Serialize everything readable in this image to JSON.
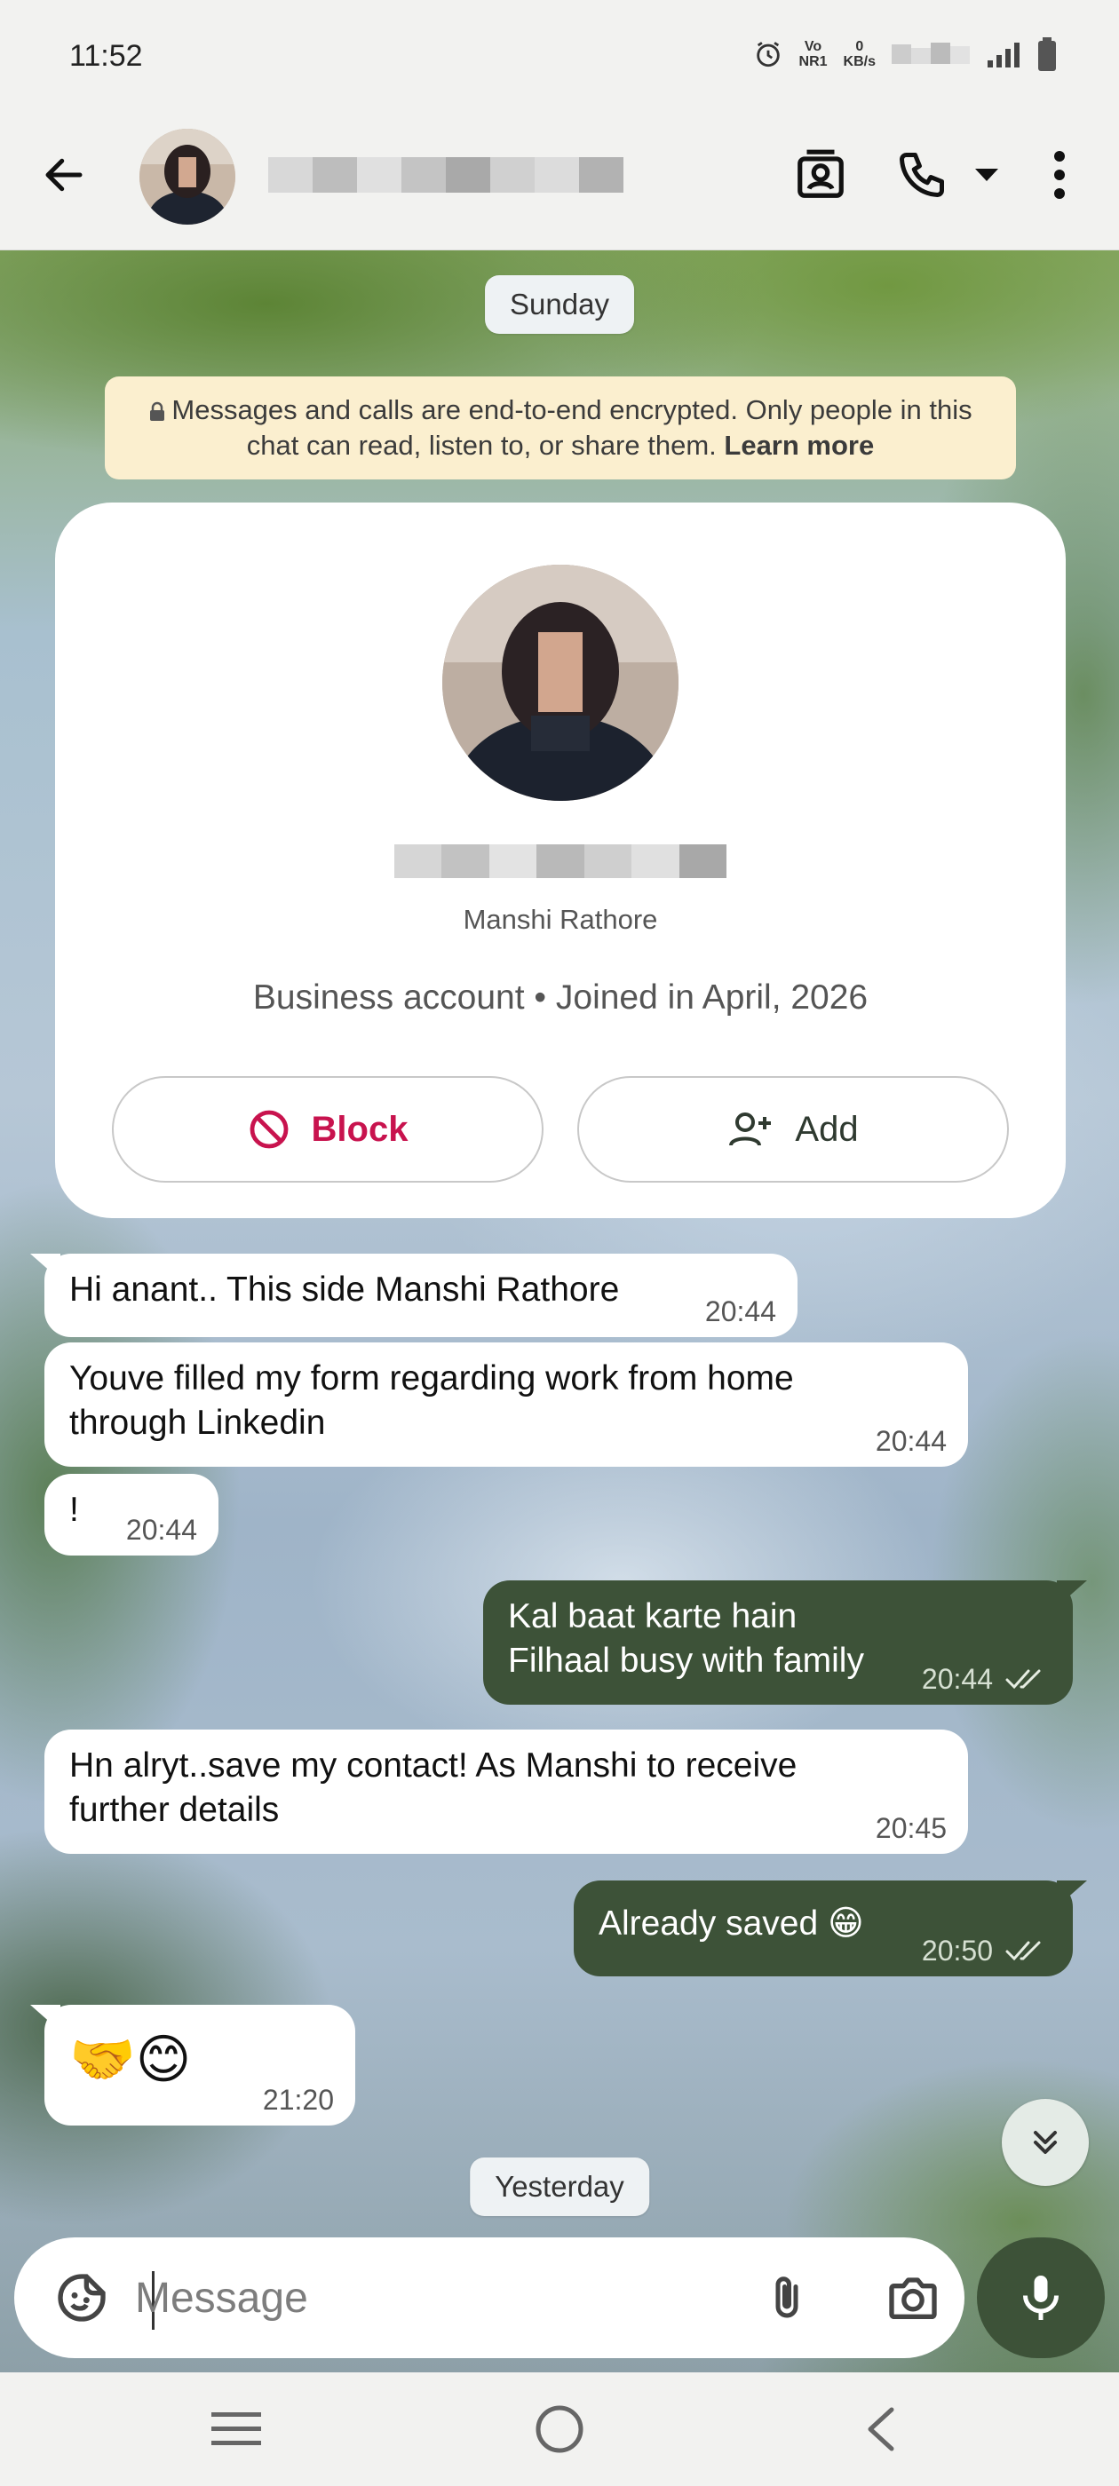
{
  "status_bar": {
    "time": "11:52",
    "volte_top": "Vo",
    "volte_bottom": "NR1",
    "speed_value": "0",
    "speed_unit": "KB/s"
  },
  "header": {
    "avatar_icon": "avatar-photo",
    "icons": [
      "back-arrow-icon",
      "contact-card-icon",
      "phone-icon",
      "dropdown-icon",
      "more-vert-icon"
    ]
  },
  "chat": {
    "day_sunday": "Sunday",
    "encryption": {
      "text": "Messages and calls are end-to-end encrypted. Only people in this chat can read, listen to, or share them.",
      "link": "Learn more"
    },
    "profile_card": {
      "subname": "Manshi Rathore",
      "meta": "Business account • Joined in April, 2026",
      "block_label": "Block",
      "add_label": "Add"
    },
    "messages": [
      {
        "dir": "in",
        "text": "Hi anant.. This side Manshi Rathore",
        "time": "20:44"
      },
      {
        "dir": "in",
        "line1": "Youve filled my form regarding work from home",
        "line2": "through Linkedin",
        "time": "20:44"
      },
      {
        "dir": "in",
        "text": "!",
        "time": "20:44"
      },
      {
        "dir": "out",
        "line1": "Kal baat karte hain",
        "line2": "Filhaal busy with family",
        "time": "20:44"
      },
      {
        "dir": "in",
        "line1": "Hn alryt..save my contact!  As Manshi to receive",
        "line2": "further details",
        "time": "20:45"
      },
      {
        "dir": "out",
        "text": "Already saved 😁",
        "time": "20:50"
      },
      {
        "dir": "in",
        "text": "🤝😊",
        "time": "21:20"
      }
    ],
    "day_yesterday": "Yesterday"
  },
  "composer": {
    "placeholder": "Message"
  },
  "colors": {
    "outgoing_bubble": "#3d5238",
    "block_red": "#c8134e",
    "notice_bg": "#fbefcf"
  }
}
